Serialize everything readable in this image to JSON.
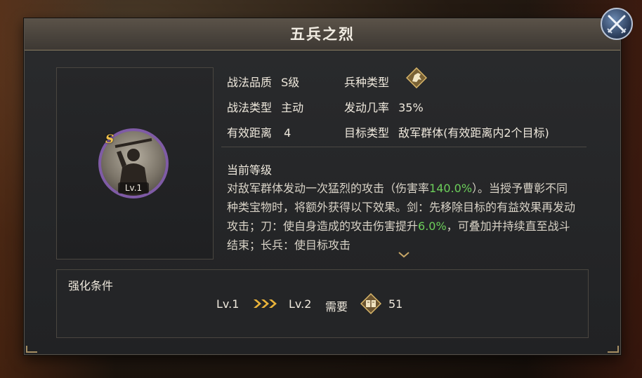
{
  "title": "五兵之烈",
  "skill": {
    "grade": "S",
    "level_badge": "Lv.1",
    "quality_label": "战法品质",
    "quality_value": "S级",
    "type_label": "战法类型",
    "type_value": "主动",
    "range_label": "有效距离",
    "range_value": "4",
    "troop_label": "兵种类型",
    "troop_icon": "cavalry-horse-icon",
    "chance_label": "发动几率",
    "chance_value": "35%",
    "target_label": "目标类型",
    "target_value": "敌军群体(有效距离内2个目标)"
  },
  "description": {
    "heading": "当前等级",
    "part1": "对敌军群体发动一次猛烈的攻击（伤害率",
    "highlight1": "140.0%",
    "part2": "）。当授予曹彰不同种类宝物时，将额外获得以下效果。剑：先移除目标的有益效果再发动攻击；刀：使自身造成的攻击伤害提升",
    "highlight2": "6.0%",
    "part3": "，可叠加并持续直至战斗结束；长兵：使目标攻击"
  },
  "upgrade": {
    "heading": "强化条件",
    "from_level": "Lv.1",
    "to_level": "Lv.2",
    "need_label": "需要",
    "item_icon": "skill-book-icon",
    "need_count": "51"
  },
  "colors": {
    "highlight": "#6ccf5a",
    "accent_gold": "#f2c24a",
    "portrait_ring": "#7f5ba6"
  }
}
